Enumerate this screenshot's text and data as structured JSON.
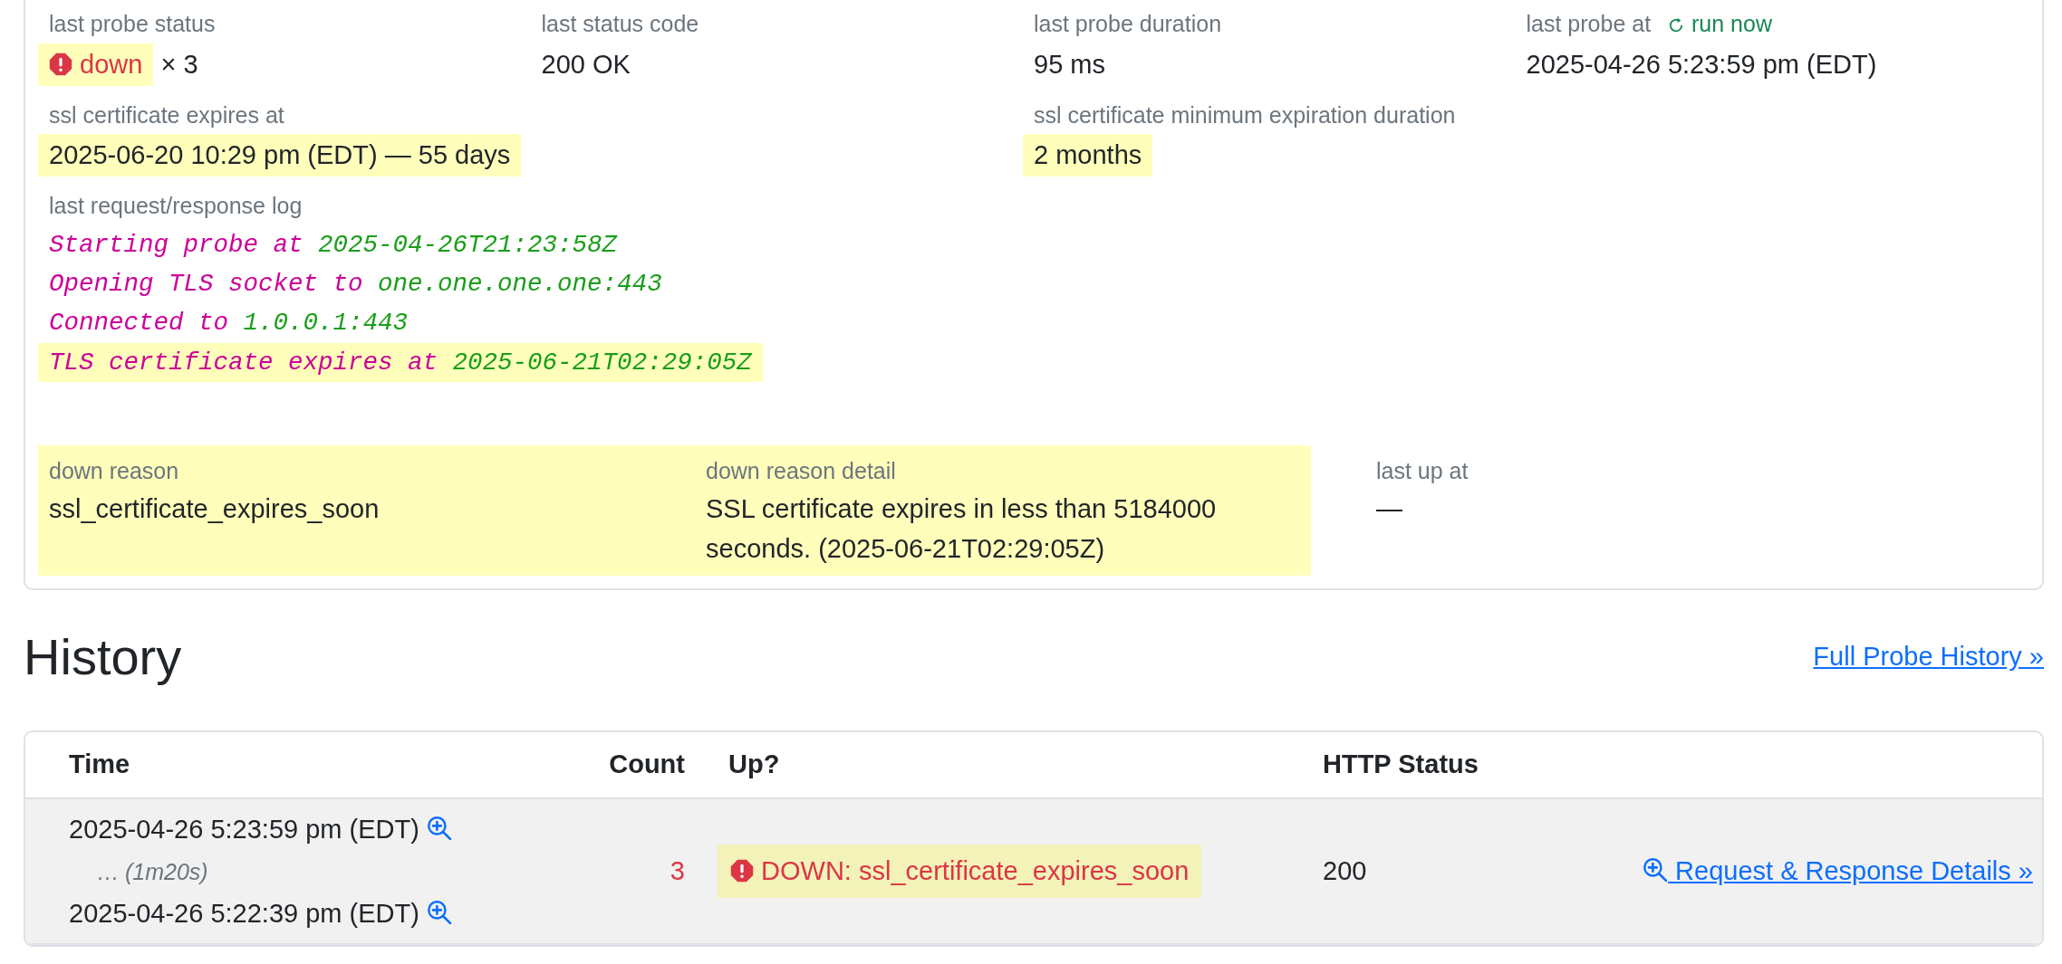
{
  "summary_fields": [
    {
      "label": "last probe status",
      "kind": "status",
      "value": "down",
      "up": false,
      "suffix": "× 3",
      "highlighted": true
    },
    {
      "label": "last status code",
      "kind": "text",
      "value": "200 OK",
      "highlighted": false
    },
    {
      "label": "last probe duration",
      "kind": "text",
      "value": "95 ms",
      "highlighted": false
    },
    {
      "label": "last probe at",
      "kind": "text",
      "action": "run now",
      "value": "2025-04-26 5:23:59 pm (EDT)",
      "highlighted": false
    }
  ],
  "ssl_fields": [
    {
      "label": "ssl certificate expires at",
      "value": "2025-06-20 10:29 pm (EDT) — 55 days",
      "highlighted": true
    },
    {
      "label": "ssl certificate minimum expiration duration",
      "value": "2 months",
      "highlighted": true
    }
  ],
  "log": {
    "label": "last request/response log",
    "lines": [
      {
        "text": "Starting probe at",
        "value": "2025-04-26T21:23:58Z",
        "highlighted": false
      },
      {
        "text": "Opening TLS socket to",
        "value": "one.one.one.one:443",
        "highlighted": false
      },
      {
        "text": "Connected to",
        "value": "1.0.0.1:443",
        "highlighted": false
      },
      {
        "text": "TLS certificate expires at",
        "value": "2025-06-21T02:29:05Z",
        "highlighted": true
      }
    ]
  },
  "down_fields": [
    {
      "label": "down reason",
      "value": "ssl_certificate_expires_soon",
      "highlighted": true
    },
    {
      "label": "down reason detail",
      "value": "SSL certificate expires in less than 5184000 seconds. (2025-06-21T02:29:05Z)",
      "highlighted": true
    },
    {
      "label": "last up at",
      "value": "—",
      "highlighted": false
    }
  ],
  "history": {
    "title": "History",
    "link": "Full Probe History »",
    "columns": [
      "Time",
      "Count",
      "Up?",
      "HTTP Status"
    ],
    "rows": [
      {
        "start": "2025-04-26 5:23:59 pm (EDT)",
        "duration": "… *(1m20s)*",
        "end": "2025-04-26 5:22:39 pm (EDT)",
        "count": "3",
        "up": false,
        "up_text": "DOWN: ssl_certificate_expires_soon",
        "highlighted": true,
        "http_status": "200",
        "details": "Request & Response Details »"
      }
    ]
  }
}
